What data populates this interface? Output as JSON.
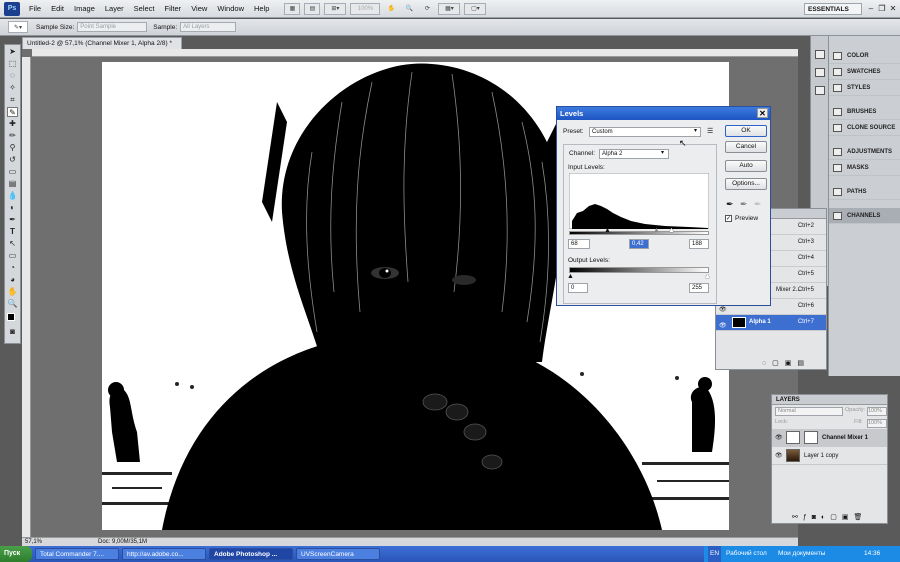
{
  "app": {
    "logo": "Ps",
    "workspace": "ESSENTIALS",
    "zoom": "100%"
  },
  "menus": [
    "File",
    "Edit",
    "Image",
    "Layer",
    "Select",
    "Filter",
    "View",
    "Window",
    "Help"
  ],
  "window_controls": {
    "minimize": "–",
    "restore": "❐",
    "close": "✕"
  },
  "options": {
    "sample_size_label": "Sample Size:",
    "sample_size_value": "Point Sample",
    "sample_label": "Sample:",
    "sample_value": "All Layers"
  },
  "document": {
    "tab_title": "Untitled-2 @ 57,1% (Channel Mixer 1, Alpha 2/8) *",
    "zoom": "57,1%",
    "doc_info": "Doc: 9,00M/35,1M"
  },
  "panels": {
    "names": [
      "COLOR",
      "SWATCHES",
      "STYLES",
      "BRUSHES",
      "CLONE SOURCE",
      "ADJUSTMENTS",
      "MASKS",
      "PATHS",
      "CHANNELS"
    ],
    "active": "CHANNELS"
  },
  "channels": [
    {
      "label": "",
      "key": "Ctrl+2"
    },
    {
      "label": "",
      "key": "Ctrl+3"
    },
    {
      "label": "",
      "key": "Ctrl+4"
    },
    {
      "label": "",
      "key": "Ctrl+5"
    },
    {
      "label": "Mixer 2...",
      "key": "Ctrl+5"
    },
    {
      "label": "",
      "key": "Ctrl+6"
    },
    {
      "label": "Alpha 1",
      "key": "Ctrl+7"
    }
  ],
  "layers": {
    "title": "LAYERS",
    "blend": "Normal",
    "opacity_label": "Opacity:",
    "opacity": "100%",
    "lock_label": "Lock:",
    "fill_label": "Fill:",
    "fill": "100%",
    "items": [
      {
        "name": "Channel Mixer 1"
      },
      {
        "name": "Layer 1 copy"
      }
    ]
  },
  "levels": {
    "title": "Levels",
    "preset_label": "Preset:",
    "preset_value": "Custom",
    "channel_label": "Channel:",
    "channel_value": "Alpha 2",
    "input_label": "Input Levels:",
    "input_black": "68",
    "input_gamma": "0,42",
    "input_white": "188",
    "output_label": "Output Levels:",
    "output_black": "0",
    "output_white": "255",
    "ok": "OK",
    "cancel": "Cancel",
    "auto": "Auto",
    "options": "Options...",
    "preview": "Preview"
  },
  "taskbar": {
    "start": "Пуск",
    "tasks": [
      {
        "label": "Total Commander 7...."
      },
      {
        "label": "http://av.adobe.co..."
      },
      {
        "label": "Adobe Photoshop ..."
      },
      {
        "label": "UVScreenCamera"
      }
    ],
    "lang": "EN",
    "desktop": "Рабочий стол",
    "docs": "Мои документы",
    "clock": "14:36"
  }
}
